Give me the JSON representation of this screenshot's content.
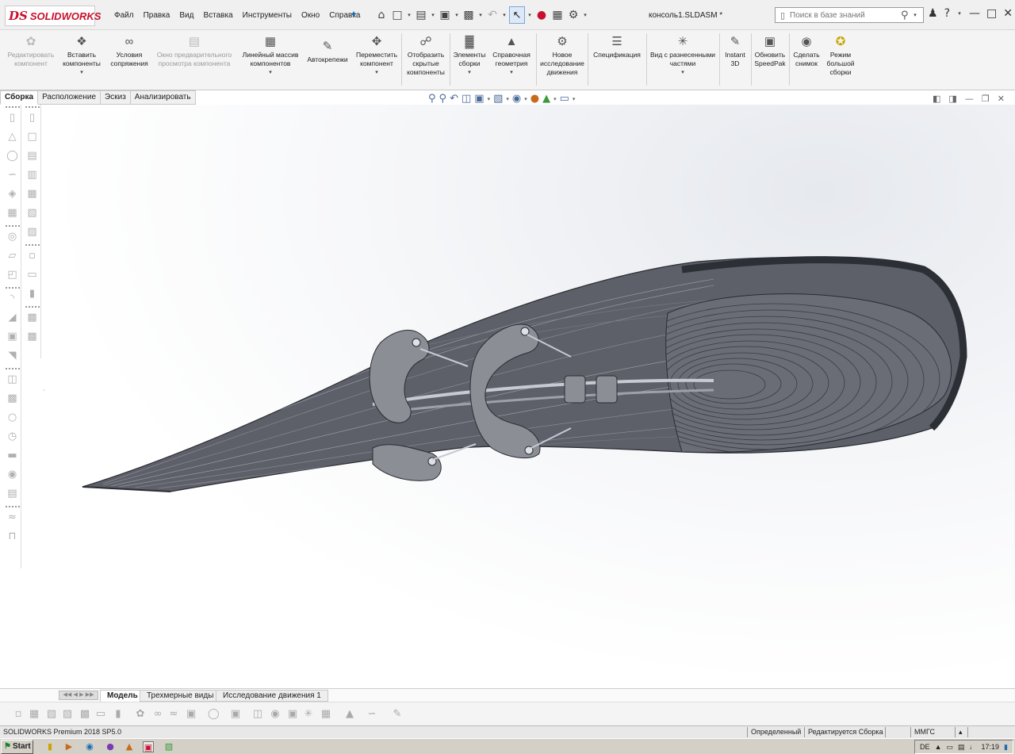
{
  "app": {
    "logo_ds": "DS",
    "logo_name": "SOLIDWORKS",
    "document_title": "консоль1.SLDASM *"
  },
  "menu": [
    "Файл",
    "Правка",
    "Вид",
    "Вставка",
    "Инструменты",
    "Окно",
    "Справка"
  ],
  "search": {
    "placeholder": "Поиск в базе знаний"
  },
  "ribbon": {
    "edit_component": "Редактировать компонент",
    "insert_components": "Вставить компоненты",
    "mates": "Условия сопряжения",
    "preview_window": "Окно предварительного просмотра компонента",
    "linear_pattern": "Линейный массив компонентов",
    "smart_fasteners": "Автокрепежи",
    "move_component": "Переместить компонент",
    "show_hidden": "Отобразить скрытые компоненты",
    "assembly_features": "Элементы сборки",
    "reference_geometry": "Справочная геометрия",
    "new_motion_study": "Новое исследование движения",
    "bom": "Спецификация",
    "exploded_view": "Вид с разнесенными частями",
    "instant3d": "Instant 3D",
    "update_speedpak": "Обновить SpeedPak",
    "snapshot": "Сделать снимок",
    "large_assembly": "Режим большой сборки"
  },
  "command_tabs": [
    "Сборка",
    "Расположение",
    "Эскиз",
    "Анализировать"
  ],
  "model_tabs": [
    "Модель",
    "Трехмерные виды",
    "Исследование движения 1"
  ],
  "status": {
    "product": "SOLIDWORKS Premium 2018 SP5.0",
    "defined": "Определенный",
    "editing": "Редактируется Сборка",
    "units": "ММГС"
  },
  "taskbar": {
    "start": "Start",
    "lang": "DE",
    "time": "17:19"
  },
  "colors": {
    "brand": "#c8102e",
    "model_fill": "#5e6069",
    "model_dark": "#3a3c44",
    "bracket_fill": "#8c8e96"
  }
}
